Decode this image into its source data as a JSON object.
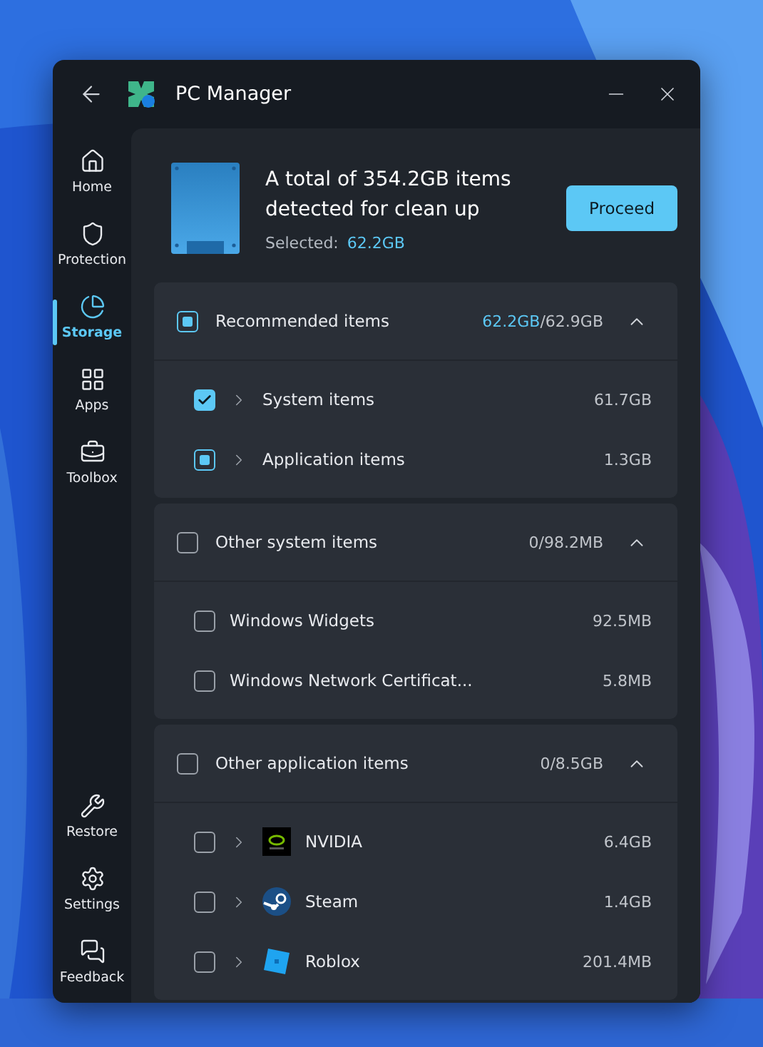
{
  "window": {
    "title": "PC Manager"
  },
  "sidebar": {
    "items": [
      {
        "label": "Home",
        "selected": false
      },
      {
        "label": "Protection",
        "selected": false
      },
      {
        "label": "Storage",
        "selected": true
      },
      {
        "label": "Apps",
        "selected": false
      },
      {
        "label": "Toolbox",
        "selected": false
      }
    ],
    "bottom_items": [
      {
        "label": "Restore",
        "selected": false
      },
      {
        "label": "Settings",
        "selected": false
      },
      {
        "label": "Feedback",
        "selected": false
      }
    ]
  },
  "summary": {
    "headline": "A total of 354.2GB items detected for clean up",
    "selected_label": "Selected:",
    "selected_value": "62.2GB",
    "button": "Proceed"
  },
  "groups": [
    {
      "title": "Recommended items",
      "checked": true,
      "partial": true,
      "size_selected": "62.2GB",
      "size_total": "/62.9GB",
      "expanded": true,
      "items": [
        {
          "name": "System items",
          "checked": true,
          "partial": false,
          "expandable": true,
          "kind": "plain",
          "size": "61.7GB"
        },
        {
          "name": "Application items",
          "checked": true,
          "partial": true,
          "expandable": true,
          "kind": "plain",
          "size": "1.3GB"
        }
      ]
    },
    {
      "title": "Other system items",
      "checked": false,
      "partial": false,
      "size_selected": "0",
      "size_total": "/98.2MB",
      "expanded": true,
      "items": [
        {
          "name": "Windows Widgets",
          "checked": false,
          "partial": false,
          "expandable": false,
          "kind": "plain",
          "size": "92.5MB"
        },
        {
          "name": "Windows Network Certificat...",
          "checked": false,
          "partial": false,
          "expandable": false,
          "kind": "plain",
          "size": "5.8MB"
        }
      ]
    },
    {
      "title": "Other application items",
      "checked": false,
      "partial": false,
      "size_selected": "0",
      "size_total": "/8.5GB",
      "expanded": true,
      "items": [
        {
          "name": "NVIDIA",
          "checked": false,
          "partial": false,
          "expandable": true,
          "kind": "gpu",
          "size": "6.4GB"
        },
        {
          "name": "Steam",
          "checked": false,
          "partial": false,
          "expandable": true,
          "kind": "game-store",
          "size": "1.4GB"
        },
        {
          "name": "Roblox",
          "checked": false,
          "partial": false,
          "expandable": true,
          "kind": "game",
          "size": "201.4MB"
        }
      ]
    }
  ]
}
